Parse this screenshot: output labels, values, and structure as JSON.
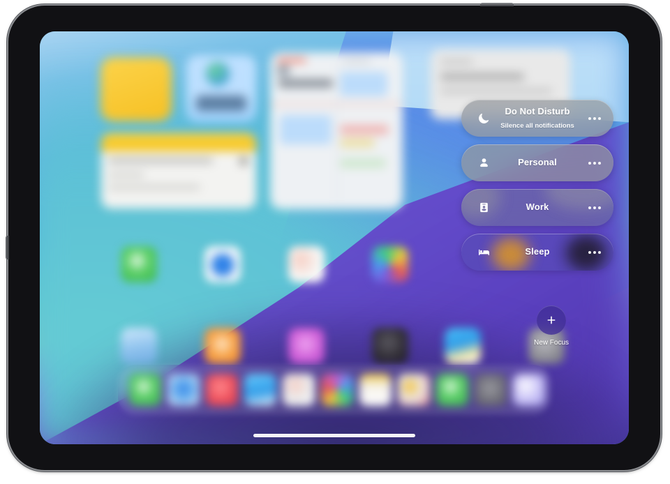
{
  "device": {
    "name": "iPad",
    "side_button": "side-button",
    "top_button": "top-button"
  },
  "home_screen": {
    "wallpaper_colors": {
      "sky_light_blue": "#bfe0f8",
      "blue": "#568cee",
      "teal": "#64cbd4",
      "purple": "#6a4ace",
      "deep_purple": "#4e36aa"
    },
    "widgets": [
      {
        "name": "notes-yellow-widget",
        "color": "#f6c023"
      },
      {
        "name": "blue-small-widget",
        "color": "#bfe0ff"
      },
      {
        "name": "notes-list-widget",
        "color": "#f3f3f1"
      },
      {
        "name": "calendar-widget",
        "color": "#eef1f4"
      },
      {
        "name": "top-right-widget",
        "color": "#e9e9e9"
      }
    ],
    "app_rows": [
      [
        {
          "name": "app-icon-green",
          "color": "#4cc45a"
        },
        {
          "name": "app-icon-blue-white",
          "color": "#e8eef6",
          "accent": "#2f82e8"
        },
        {
          "name": "app-icon-white-pink",
          "color": "#f4f3f2",
          "accent": "#f0a090"
        },
        {
          "name": "app-icon-multicolor",
          "color": "#9b6fe0"
        }
      ],
      [
        {
          "name": "app-icon-light-blue",
          "color": "#9fcef4"
        },
        {
          "name": "app-icon-orange",
          "color": "#f59a3c"
        },
        {
          "name": "app-icon-magenta",
          "color": "#d060d8"
        },
        {
          "name": "app-icon-dark",
          "color": "#2e2b33"
        },
        {
          "name": "app-icon-weather",
          "color": "#34a8f0"
        },
        {
          "name": "app-icon-gray",
          "color": "#8f8f96"
        }
      ]
    ],
    "dock_icons": [
      {
        "name": "dock-icon-green",
        "color": "#4cc45a"
      },
      {
        "name": "dock-icon-blue",
        "color": "#5fa8e8"
      },
      {
        "name": "dock-icon-red",
        "color": "#ef4f5a"
      },
      {
        "name": "dock-icon-sky",
        "color": "#34a8f0"
      },
      {
        "name": "dock-icon-white",
        "color": "#e6e6e6"
      },
      {
        "name": "dock-icon-photos",
        "color": "#f2f2f2"
      },
      {
        "name": "dock-icon-yellow-white",
        "color": "#f0f0ee"
      },
      {
        "name": "dock-icon-shortcuts",
        "color": "#ece9e6"
      },
      {
        "name": "dock-icon-green2",
        "color": "#4cc45a"
      },
      {
        "name": "dock-icon-gray",
        "color": "#8d8d92"
      },
      {
        "name": "dock-icon-lavender",
        "color": "#b9b5f0"
      }
    ],
    "home_indicator": "home-indicator"
  },
  "focus_panel": {
    "items": [
      {
        "id": "do-not-disturb",
        "icon": "moon-icon",
        "title": "Do Not Disturb",
        "subtitle": "Silence all notifications",
        "more_label": "more-options"
      },
      {
        "id": "personal",
        "icon": "person-icon",
        "title": "Personal",
        "subtitle": "",
        "more_label": "more-options"
      },
      {
        "id": "work",
        "icon": "id-badge-icon",
        "title": "Work",
        "subtitle": "",
        "more_label": "more-options"
      },
      {
        "id": "sleep",
        "icon": "bed-icon",
        "title": "Sleep",
        "subtitle": "",
        "more_label": "more-options"
      }
    ],
    "new_focus": {
      "icon": "plus-icon",
      "label": "New Focus"
    }
  }
}
